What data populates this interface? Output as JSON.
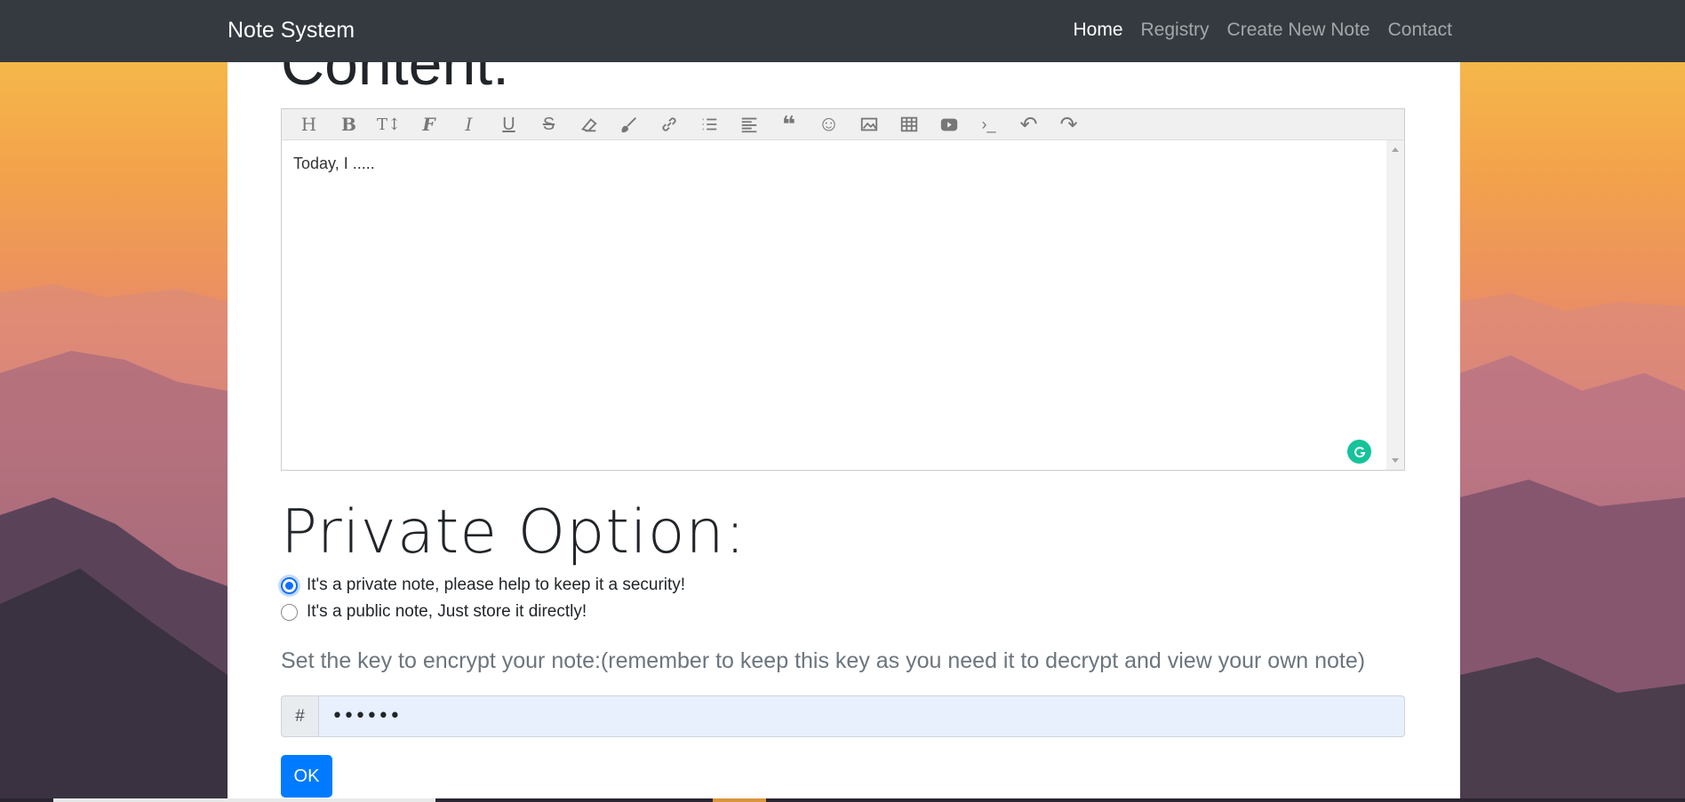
{
  "navbar": {
    "brand": "Note System",
    "links": [
      "Home",
      "Registry",
      "Create New Note",
      "Contact"
    ],
    "active": "Home"
  },
  "content_section": {
    "heading": "Content:"
  },
  "editor": {
    "toolbar_icons": [
      "heading-icon",
      "bold-icon",
      "text-size-icon",
      "font-icon",
      "italic-icon",
      "underline-icon",
      "strikethrough-icon",
      "eraser-icon",
      "brush-icon",
      "link-icon",
      "list-icon",
      "align-icon",
      "quote-icon",
      "emoji-icon",
      "image-icon",
      "table-icon",
      "video-icon",
      "code-icon",
      "undo-icon",
      "redo-icon"
    ],
    "toolbar_glyphs": [
      "H",
      "B",
      "T↕",
      "F",
      "I",
      "U",
      "S",
      "",
      "",
      "",
      "",
      "",
      "❝",
      "☺",
      "",
      "",
      "",
      "›_",
      "↶",
      "↷"
    ],
    "text": "Today, I ....."
  },
  "private_option": {
    "heading": "Private Option:",
    "options": [
      {
        "label": "It's a private note, please help to keep it a security!",
        "checked": true
      },
      {
        "label": "It's a public note, Just store it directly!",
        "checked": false
      }
    ]
  },
  "key": {
    "label": "Set the key to encrypt your note:(remember to keep this key as you need it to decrypt and view your own note)",
    "prefix": "#",
    "value": "••••••"
  },
  "ok_button": "OK",
  "colors": {
    "navbar": "#343a40",
    "primary": "#007bff",
    "grammarly": "#15c39a"
  }
}
